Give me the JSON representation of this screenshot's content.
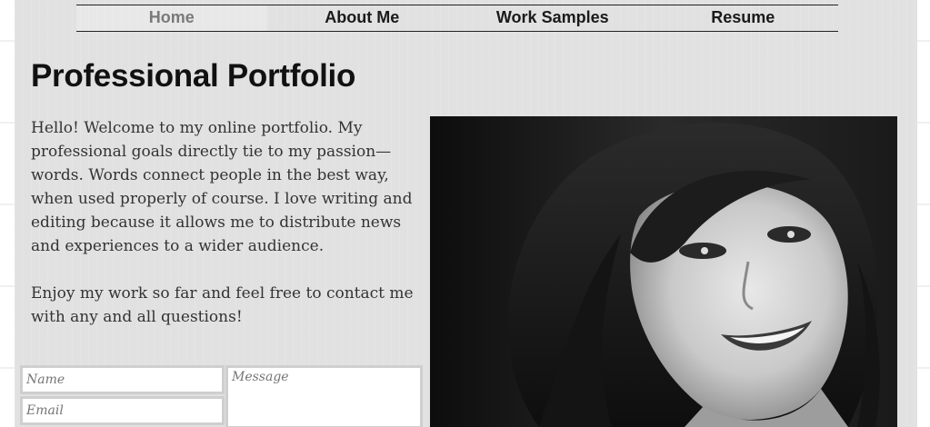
{
  "nav": {
    "items": [
      {
        "label": "Home",
        "active": true
      },
      {
        "label": "About Me",
        "active": false
      },
      {
        "label": "Work Samples",
        "active": false
      },
      {
        "label": "Resume",
        "active": false
      }
    ]
  },
  "main": {
    "title": "Professional Portfolio",
    "paragraphs": [
      "Hello! Welcome to my online portfolio. My professional goals directly tie to my passion—words. Words connect people in the best way, when used properly of course. I love writing and editing because it allows me to distribute news and experiences to a wider audience.",
      "Enjoy my work so far and feel free to contact me with any and all questions!"
    ]
  },
  "contact_form": {
    "name_placeholder": "Name",
    "email_placeholder": "Email",
    "message_placeholder": "Message"
  },
  "photo": {
    "description_icon": "portrait-photo"
  },
  "colors": {
    "page_bg": "#e1e1e1",
    "active_nav": "#7a7a7a",
    "text": "#333333"
  }
}
